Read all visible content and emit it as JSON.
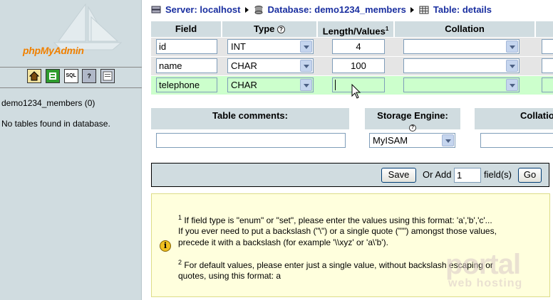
{
  "sidebar": {
    "logo_pre": "php",
    "logo_my": "MyAdmin",
    "icons": [
      "home-icon",
      "sql-icon",
      "query-window-icon",
      "docs-icon",
      "settings-icon"
    ],
    "icon_labels": [
      "",
      "",
      "SQL",
      "?",
      ""
    ],
    "db_link": "demo1234_members (0)",
    "no_tables": "No tables found in database."
  },
  "breadcrumb": {
    "server": "Server: localhost",
    "database": "Database: demo1234_members",
    "table": "Table: details"
  },
  "columns": {
    "field": "Field",
    "type": "Type",
    "length": "Length/Values",
    "length_sup": "1",
    "collation": "Collation"
  },
  "fields": [
    {
      "name": "id",
      "type": "INT",
      "length": "4",
      "collation": ""
    },
    {
      "name": "name",
      "type": "CHAR",
      "length": "100",
      "collation": ""
    },
    {
      "name": "telephone",
      "type": "CHAR",
      "length": "",
      "collation": ""
    }
  ],
  "table_opts": {
    "comments_label": "Table comments:",
    "comments_value": "",
    "engine_label": "Storage Engine:",
    "engine_value": "MyISAM",
    "collation_label": "Collatio"
  },
  "actions": {
    "save": "Save",
    "or_add": "Or Add",
    "add_count": "1",
    "fields_label": "field(s)",
    "go": "Go"
  },
  "notes": {
    "n1_sup": "1",
    "n1_line1": " If field type is \"enum\" or \"set\", please enter the values using this format: 'a','b','c'...",
    "n1_line2": "If you ever need to put a backslash (\"\\\") or a single quote (\"'\") amongst those values,",
    "n1_line3": "precede it with a backslash (for example '\\\\xyz' or 'a\\'b').",
    "n2_sup": "2",
    "n2_line1": " For default values, please enter just a single value, without backslash escaping or",
    "n2_line2": "quotes, using this format: a"
  },
  "watermark": {
    "line1": "portal",
    "line2": "web hosting"
  },
  "colors": {
    "sidebar_bg": "#d0dce0",
    "header_bg": "#d0dce0",
    "row_highlight": "#ccffcc",
    "link": "#1a2fa0",
    "logo_orange": "#f08000"
  }
}
